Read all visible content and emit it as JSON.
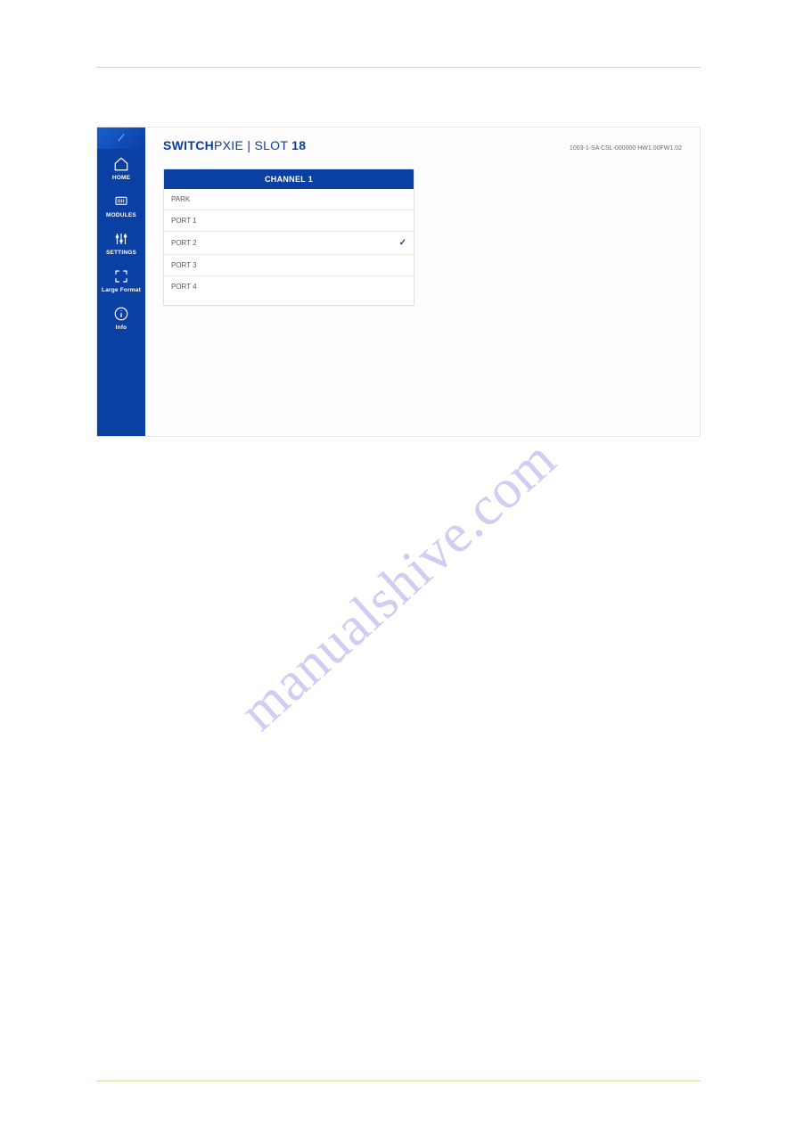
{
  "watermark": "manualshive.com",
  "sidebar": {
    "logo_mark": "⟋",
    "items": [
      {
        "label": "HOME"
      },
      {
        "label": "MODULES"
      },
      {
        "label": "SETTINGS"
      },
      {
        "label": "Large Format"
      },
      {
        "label": "Info"
      }
    ]
  },
  "header": {
    "title_bold": "SWITCH",
    "title_light": "PXIE",
    "sep": " | ",
    "slot_label": "SLOT ",
    "slot_num": "18",
    "meta": "1003-1-SA CSL-000000 HW1.00FW1.02"
  },
  "panel": {
    "title": "CHANNEL 1",
    "rows": [
      {
        "label": "PARK",
        "selected": false
      },
      {
        "label": "PORT 1",
        "selected": false
      },
      {
        "label": "PORT 2",
        "selected": true
      },
      {
        "label": "PORT 3",
        "selected": false
      },
      {
        "label": "PORT 4",
        "selected": false
      }
    ]
  },
  "glyphs": {
    "check": "✓"
  }
}
